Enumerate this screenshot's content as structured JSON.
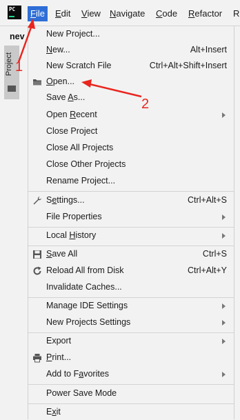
{
  "app": {
    "logo_text": "PC"
  },
  "menubar": {
    "items": [
      {
        "label": "File",
        "mnemonic": "F",
        "rest": "ile",
        "active": true
      },
      {
        "label": "Edit",
        "mnemonic": "E",
        "rest": "dit"
      },
      {
        "label": "View",
        "mnemonic": "V",
        "rest": "iew"
      },
      {
        "label": "Navigate",
        "mnemonic": "N",
        "rest": "avigate"
      },
      {
        "label": "Code",
        "mnemonic": "C",
        "rest": "ode"
      },
      {
        "label": "Refactor",
        "mnemonic": "R",
        "rest": "efactor"
      },
      {
        "label": "R",
        "mnemonic": "R",
        "rest": ""
      }
    ]
  },
  "left_panel": {
    "file_tab": "nev",
    "project_tab": "Project"
  },
  "file_menu": {
    "items": [
      {
        "pre": "",
        "mn": "",
        "post": "New Project...",
        "shortcut": ""
      },
      {
        "pre": "",
        "mn": "N",
        "post": "ew...",
        "shortcut": "Alt+Insert"
      },
      {
        "pre": "",
        "mn": "",
        "post": "New Scratch File",
        "shortcut": "Ctrl+Alt+Shift+Insert"
      },
      {
        "pre": "",
        "mn": "O",
        "post": "pen...",
        "shortcut": "",
        "icon": "folder-icon"
      },
      {
        "pre": "Save ",
        "mn": "A",
        "post": "s...",
        "shortcut": ""
      },
      {
        "pre": "Open ",
        "mn": "R",
        "post": "ecent",
        "shortcut": "",
        "submenu": true
      },
      {
        "pre": "",
        "mn": "",
        "post": "Close Project",
        "shortcut": ""
      },
      {
        "pre": "",
        "mn": "",
        "post": "Close All Projects",
        "shortcut": ""
      },
      {
        "pre": "",
        "mn": "",
        "post": "Close Other Projects",
        "shortcut": ""
      },
      {
        "pre": "",
        "mn": "",
        "post": "Rename Project...",
        "shortcut": ""
      },
      {
        "pre": "S",
        "mn": "e",
        "post": "ttings...",
        "shortcut": "Ctrl+Alt+S",
        "icon": "wrench-icon"
      },
      {
        "pre": "",
        "mn": "",
        "post": "File Properties",
        "shortcut": "",
        "submenu": true
      },
      {
        "pre": "Local ",
        "mn": "H",
        "post": "istory",
        "shortcut": "",
        "submenu": true
      },
      {
        "pre": "",
        "mn": "S",
        "post": "ave All",
        "shortcut": "Ctrl+S",
        "icon": "save-icon"
      },
      {
        "pre": "",
        "mn": "",
        "post": "Reload All from Disk",
        "shortcut": "Ctrl+Alt+Y",
        "icon": "reload-icon"
      },
      {
        "pre": "",
        "mn": "",
        "post": "Invalidate Caches...",
        "shortcut": ""
      },
      {
        "pre": "",
        "mn": "",
        "post": "Manage IDE Settings",
        "shortcut": "",
        "submenu": true
      },
      {
        "pre": "",
        "mn": "",
        "post": "New Projects Settings",
        "shortcut": "",
        "submenu": true
      },
      {
        "pre": "",
        "mn": "",
        "post": "Export",
        "shortcut": "",
        "submenu": true
      },
      {
        "pre": "",
        "mn": "P",
        "post": "rint...",
        "shortcut": "",
        "icon": "print-icon"
      },
      {
        "pre": "Add to F",
        "mn": "a",
        "post": "vorites",
        "shortcut": "",
        "submenu": true
      },
      {
        "pre": "",
        "mn": "",
        "post": "Power Save Mode",
        "shortcut": ""
      },
      {
        "pre": "E",
        "mn": "x",
        "post": "it",
        "shortcut": ""
      }
    ]
  },
  "annotations": {
    "label_1": "1",
    "label_2": "2",
    "color": "#e8251e"
  },
  "colors": {
    "menu_highlight": "#2e6ed6",
    "background": "#f2f2f2"
  }
}
